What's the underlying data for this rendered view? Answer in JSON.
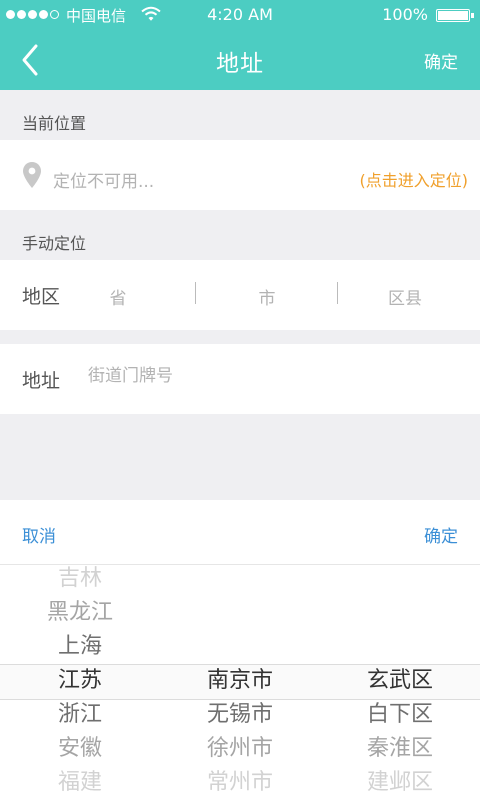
{
  "status_bar": {
    "carrier": "中国电信",
    "time": "4:20 AM",
    "battery": "100%"
  },
  "nav": {
    "title": "地址",
    "confirm": "确定",
    "back_icon": "chevron-left-icon"
  },
  "current_location": {
    "section_label": "当前位置",
    "status_text": "定位不可用...",
    "action_text": "(点击进入定位)",
    "icon": "location-pin-icon"
  },
  "manual": {
    "section_label": "手动定位",
    "region_label": "地区",
    "province_placeholder": "省",
    "city_placeholder": "市",
    "district_placeholder": "区县",
    "address_label": "地址",
    "address_placeholder": "街道门牌号",
    "address_value": ""
  },
  "picker": {
    "cancel": "取消",
    "confirm": "确定",
    "provinces": [
      "吉林",
      "黑龙江",
      "上海",
      "江苏",
      "浙江",
      "安徽",
      "福建"
    ],
    "provinces_selected": 3,
    "cities": [
      "南京市",
      "无锡市",
      "徐州市",
      "常州市"
    ],
    "cities_selected": 0,
    "districts": [
      "玄武区",
      "白下区",
      "秦淮区",
      "建邺区"
    ],
    "districts_selected": 0
  },
  "colors": {
    "header": "#4ccdc2",
    "accent_orange": "#f0a02c",
    "link_blue": "#3b8fd6"
  }
}
